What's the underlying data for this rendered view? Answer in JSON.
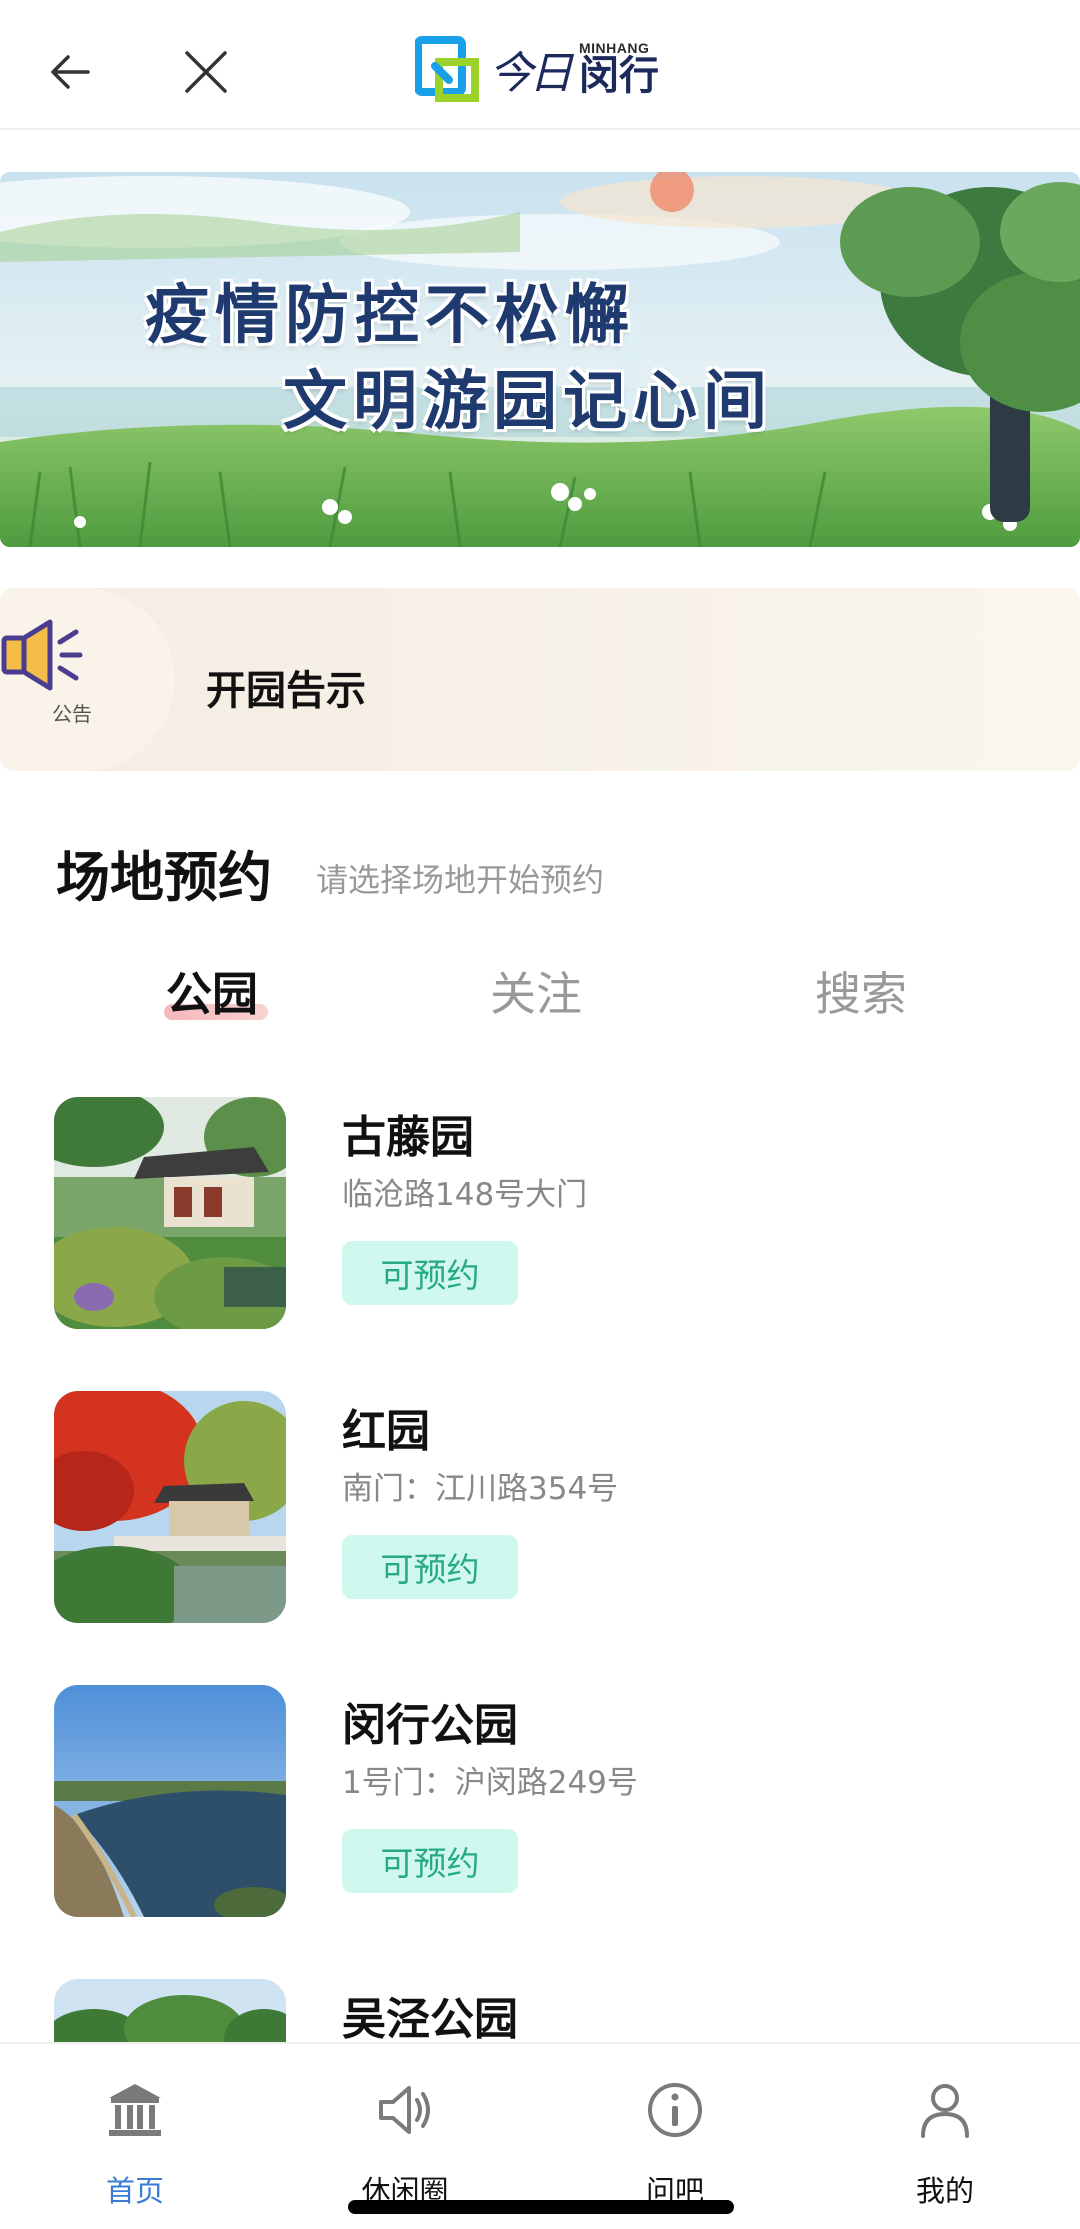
{
  "header": {
    "back_icon": "arrow-left-icon",
    "close_icon": "close-icon",
    "logo": {
      "sub": "MINHANG",
      "mark": "今日",
      "name": "闵行"
    }
  },
  "banner": {
    "line1": "疫情防控不松懈",
    "line2": "文明游园记心间"
  },
  "notice": {
    "icon": "speaker-icon",
    "tag": "公告",
    "title": "开园告示"
  },
  "section": {
    "title": "场地预约",
    "subtitle": "请选择场地开始预约"
  },
  "tabs": [
    {
      "label": "公园",
      "active": true
    },
    {
      "label": "关注",
      "active": false
    },
    {
      "label": "搜索",
      "active": false
    }
  ],
  "parks": [
    {
      "name": "古藤园",
      "address": "临沧路148号大门",
      "status": "可预约"
    },
    {
      "name": "红园",
      "address": "南门：江川路354号",
      "status": "可预约"
    },
    {
      "name": "闵行公园",
      "address": "1号门：沪闵路249号",
      "status": "可预约"
    },
    {
      "name": "吴泾公园",
      "address": "",
      "status": ""
    }
  ],
  "nav": [
    {
      "label": "首页",
      "icon": "bank-icon",
      "active": true
    },
    {
      "label": "休闲圈",
      "icon": "speaker-icon",
      "active": false
    },
    {
      "label": "问吧",
      "icon": "info-icon",
      "active": false
    },
    {
      "label": "我的",
      "icon": "user-icon",
      "active": false
    }
  ],
  "colors": {
    "accent": "#27a985",
    "badge_bg": "#d1f8ee",
    "nav_active": "#3a7bd5",
    "tab_underline": "#f2a6ad"
  }
}
